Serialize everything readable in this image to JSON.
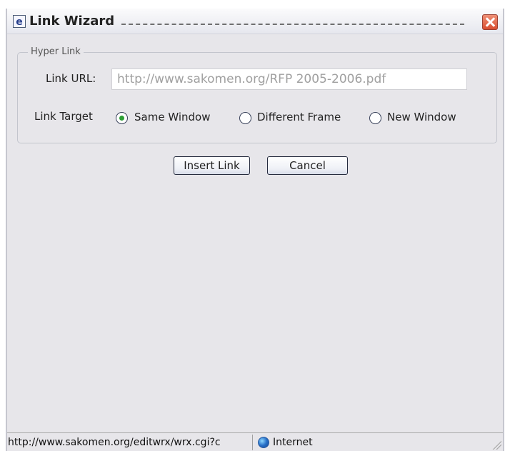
{
  "window": {
    "title": "Link Wizard",
    "close_icon": "close-icon",
    "app_icon": "ie-page-icon"
  },
  "hyperlink_group": {
    "legend": "Hyper Link",
    "url_label": "Link URL:",
    "url_value": "http://www.sakomen.org/RFP 2005-2006.pdf",
    "target_label": "Link Target",
    "targets": [
      {
        "label": "Same Window",
        "selected": true
      },
      {
        "label": "Different Frame",
        "selected": false
      },
      {
        "label": "New Window",
        "selected": false
      }
    ]
  },
  "actions": {
    "insert_label": "Insert Link",
    "cancel_label": "Cancel"
  },
  "statusbar": {
    "url": "http://www.sakomen.org/editwrx/wrx.cgi?c",
    "zone_icon": "globe-icon",
    "zone": "Internet"
  }
}
